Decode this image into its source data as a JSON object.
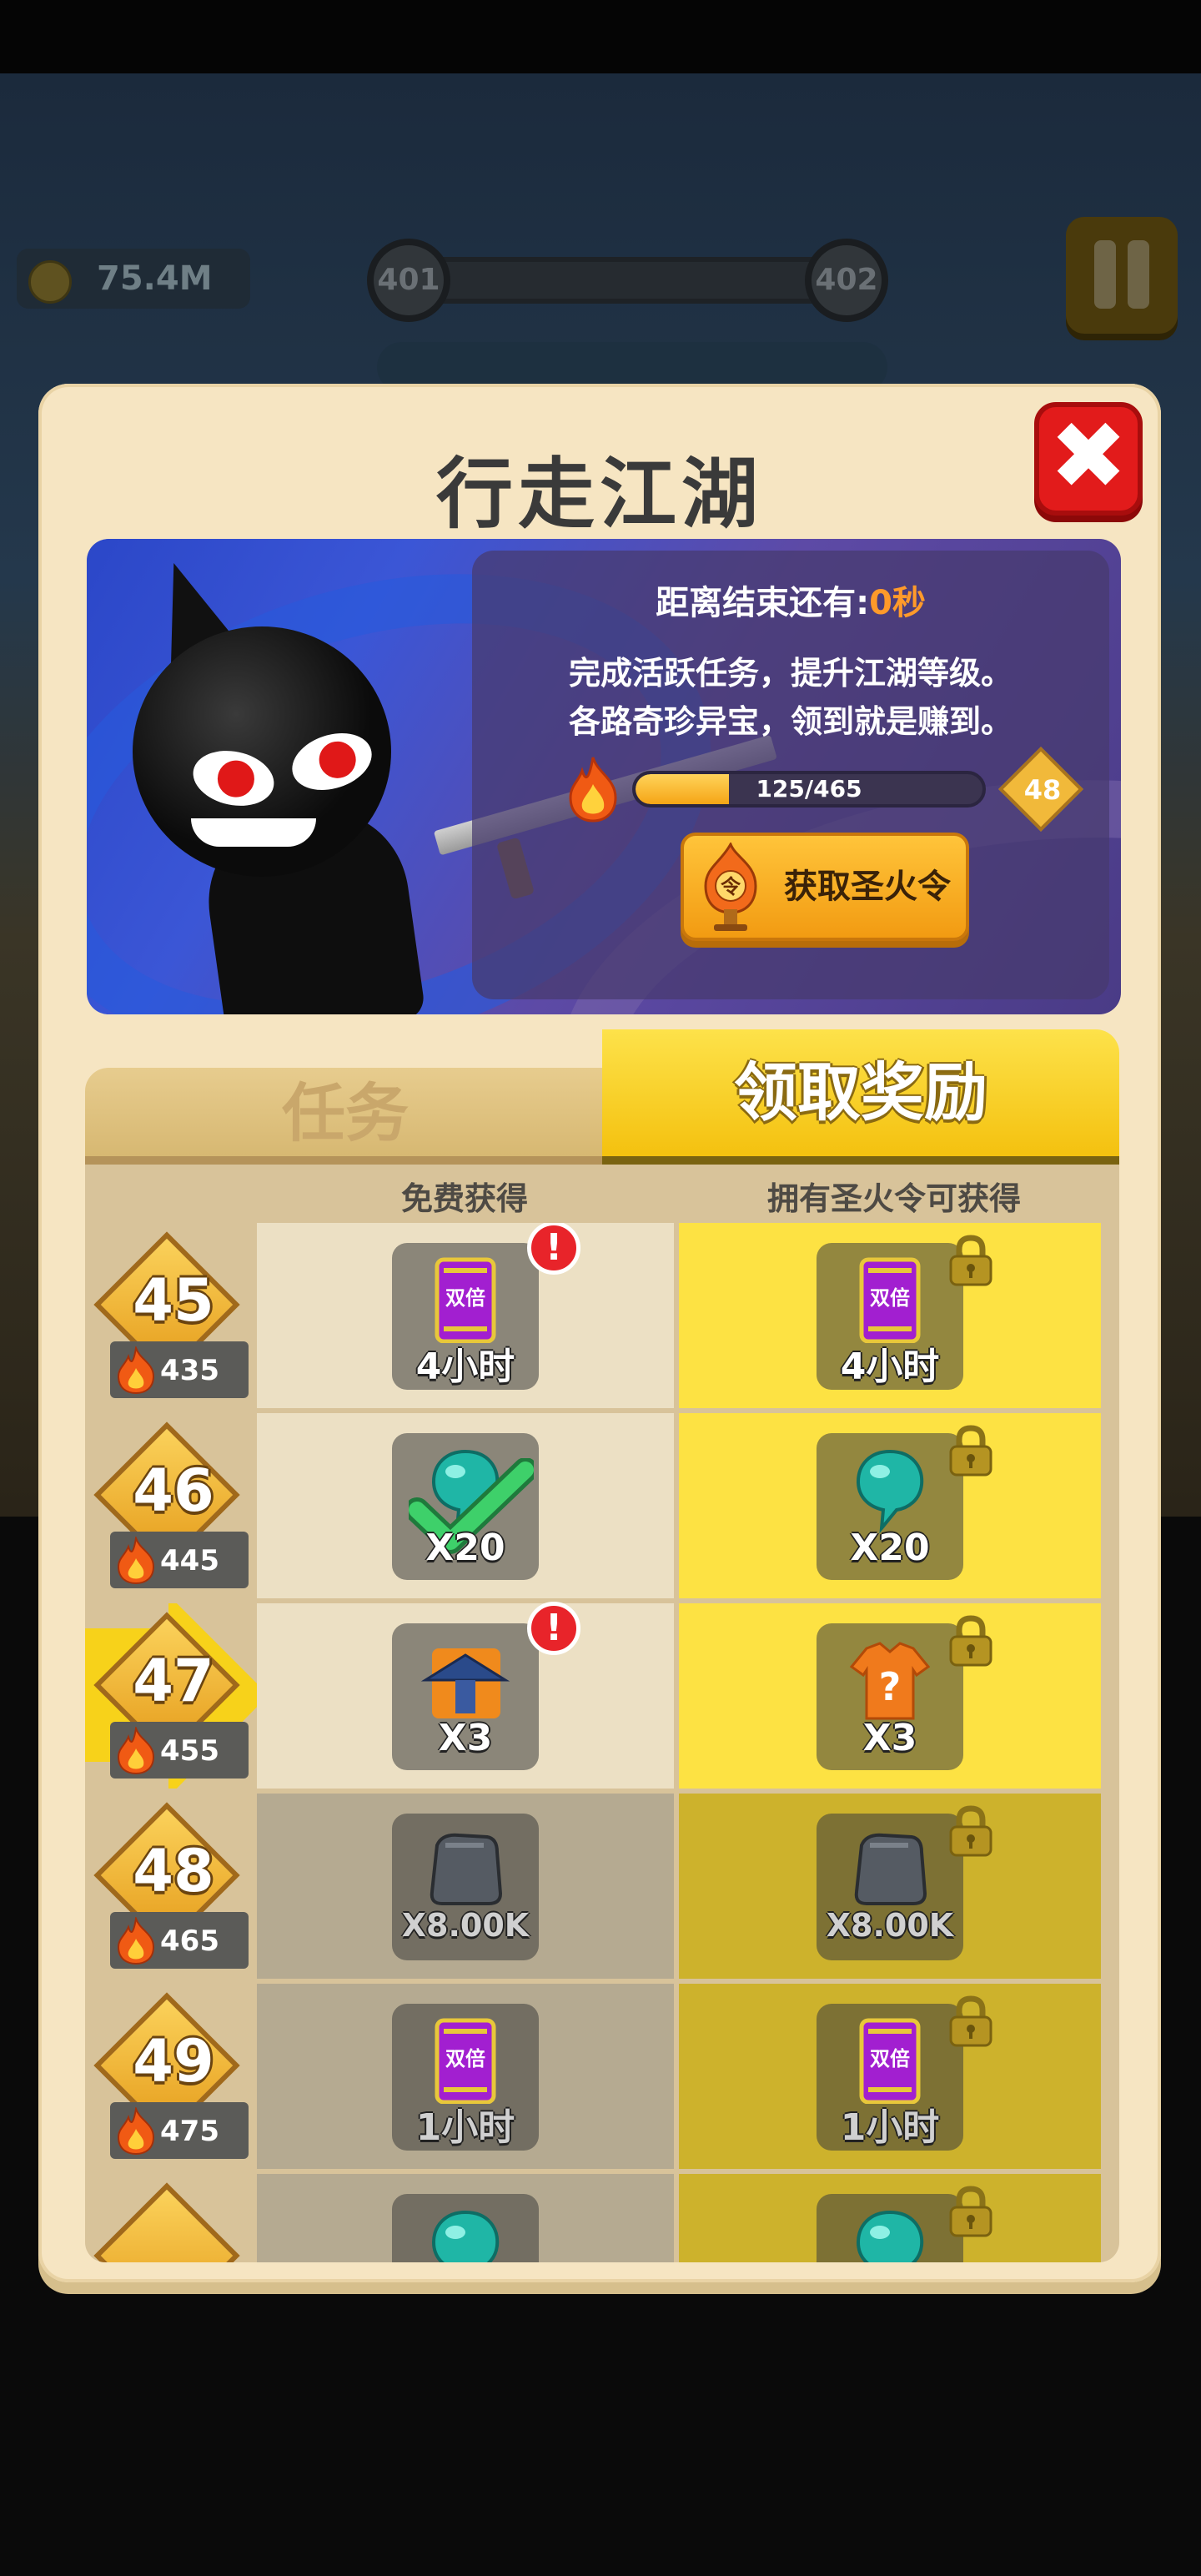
{
  "hud": {
    "coins": "75.4M",
    "level_from": "401",
    "level_to": "402"
  },
  "modal": {
    "title": "行走江湖",
    "close_symbol": "✖"
  },
  "banner": {
    "countdown_label": "距离结束还有:",
    "countdown_value": "0秒",
    "description_line1": "完成活跃任务，提升江湖等级。",
    "description_line2": "各路奇珍异宝，领到就是赚到。",
    "progress_text": "125/465",
    "progress_fraction": 0.27,
    "current_level": "48",
    "get_token_button": "获取圣火令",
    "token_icon_char": "令"
  },
  "tabs": {
    "tasks": "任务",
    "rewards": "领取奖励",
    "active": "rewards"
  },
  "table": {
    "col_free": "免费获得",
    "col_premium": "拥有圣火令可获得",
    "rows": [
      {
        "level": "45",
        "fire": "435",
        "state": "unlocked",
        "current": false,
        "free": {
          "item": "double-card",
          "title": "双倍",
          "label": "4小时",
          "alert": true,
          "claimed": false
        },
        "premium": {
          "item": "double-card",
          "title": "双倍",
          "label": "4小时",
          "locked": true
        }
      },
      {
        "level": "46",
        "fire": "445",
        "state": "unlocked",
        "current": false,
        "free": {
          "item": "teal-gem",
          "label": "X20",
          "alert": false,
          "claimed": true
        },
        "premium": {
          "item": "teal-gem",
          "label": "X20",
          "locked": true
        }
      },
      {
        "level": "47",
        "fire": "455",
        "state": "unlocked",
        "current": true,
        "free": {
          "item": "straw-hat-ninja",
          "label": "X3",
          "alert": true,
          "claimed": false
        },
        "premium": {
          "item": "mystery-shirt",
          "label": "X3",
          "locked": true
        }
      },
      {
        "level": "48",
        "fire": "465",
        "state": "dim",
        "current": false,
        "free": {
          "item": "stone-block",
          "label": "X8.00K",
          "alert": false,
          "claimed": false
        },
        "premium": {
          "item": "stone-block",
          "label": "X8.00K",
          "locked": true
        }
      },
      {
        "level": "49",
        "fire": "475",
        "state": "dim",
        "current": false,
        "free": {
          "item": "double-card",
          "title": "双倍",
          "label": "1小时",
          "alert": false,
          "claimed": false
        },
        "premium": {
          "item": "double-card",
          "title": "双倍",
          "label": "1小时",
          "locked": true
        }
      },
      {
        "level": "",
        "fire": "",
        "state": "dim",
        "current": false,
        "free": {
          "item": "teal-gem",
          "label": "",
          "alert": false,
          "claimed": false
        },
        "premium": {
          "item": "teal-gem",
          "label": "",
          "locked": true
        }
      }
    ]
  },
  "colors": {
    "premium_column": "#fde243",
    "free_column": "#ece0c4",
    "close_button": "#e21b1b",
    "countdown_accent": "#ff9a2a"
  }
}
